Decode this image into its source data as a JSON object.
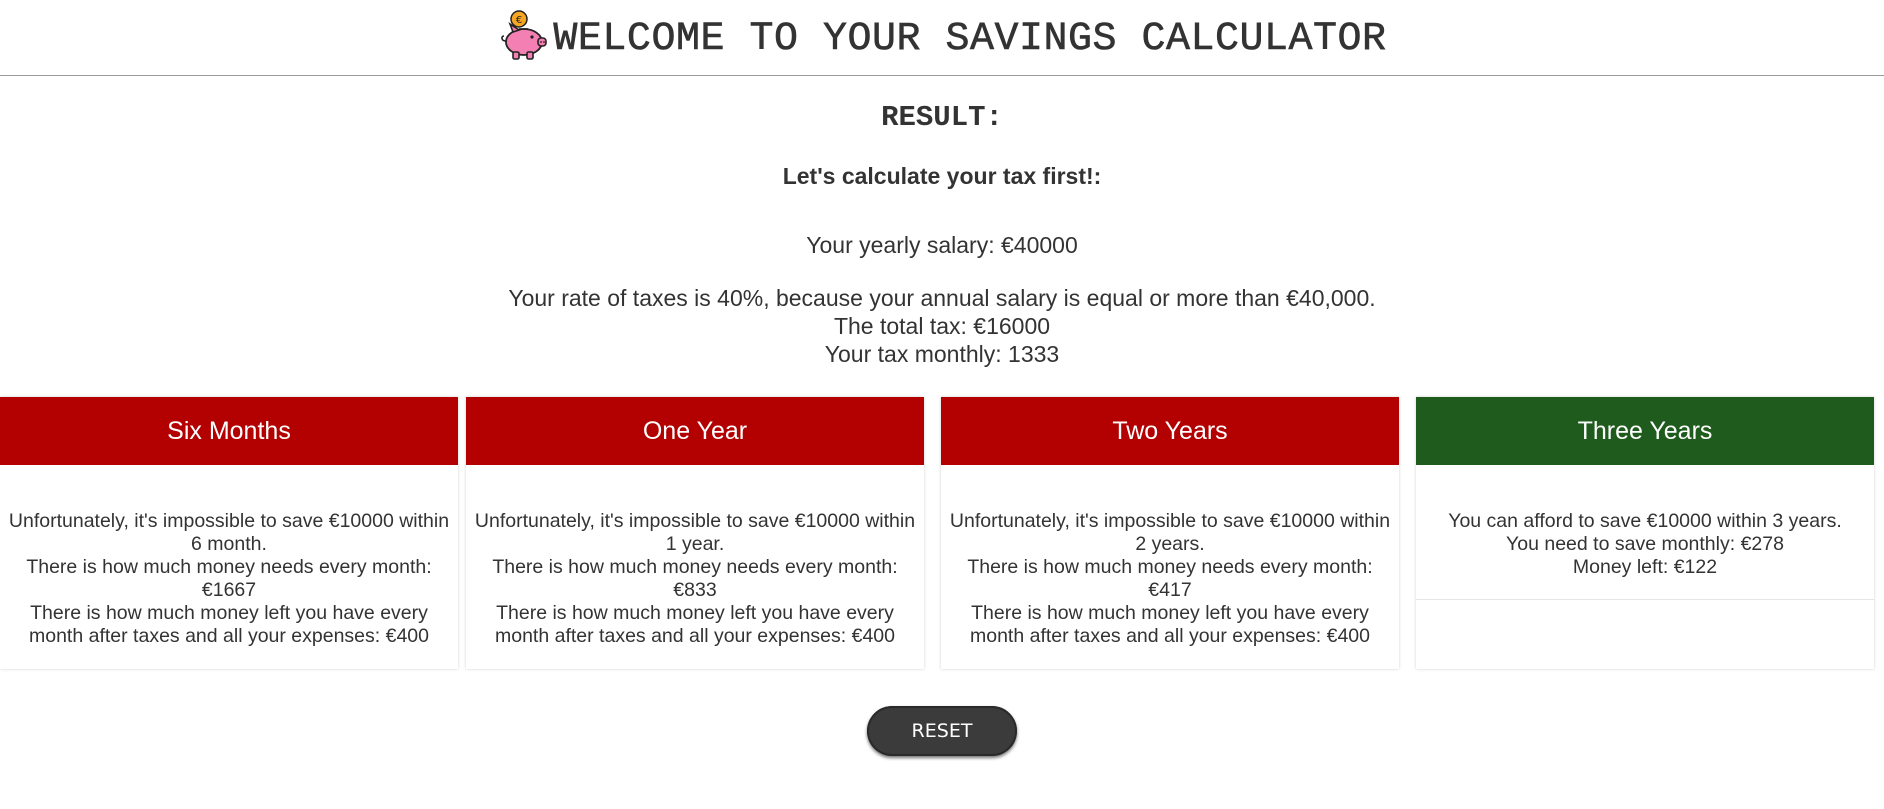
{
  "header": {
    "title": "WELCOME TO YOUR SAVINGS CALCULATOR",
    "logo_icon": "piggy-bank-coin-icon"
  },
  "result": {
    "heading": "RESULT:",
    "tax_heading": "Let's calculate your tax first!:",
    "salary_line": "Your yearly salary: €40000",
    "rate_line": "Your rate of taxes is 40%, because your annual salary is equal or more than €40,000.",
    "total_tax_line": "The total tax: €16000",
    "monthly_tax_line": "Your tax monthly: 1333"
  },
  "cards": [
    {
      "title": "Six Months",
      "color": "#b30000",
      "lines": [
        "Unfortunately, it's impossible to save €10000 within 6 month.",
        "There is how much money needs every month: €1667",
        "There is how much money left you have every month after taxes and all your expenses: €400"
      ]
    },
    {
      "title": "One Year",
      "color": "#b30000",
      "lines": [
        "Unfortunately, it's impossible to save €10000 within 1 year.",
        "There is how much money needs every month: €833",
        "There is how much money left you have every month after taxes and all your expenses: €400"
      ]
    },
    {
      "title": "Two Years",
      "color": "#b30000",
      "lines": [
        "Unfortunately, it's impossible to save €10000 within 2 years.",
        "There is how much money needs every month: €417",
        "There is how much money left you have every month after taxes and all your expenses: €400"
      ]
    },
    {
      "title": "Three Years",
      "color": "#1e5b1c",
      "lines": [
        "You can afford to save €10000 within 3 years.",
        "You need to save monthly: €278",
        "Money left: €122"
      ]
    }
  ],
  "reset_label": "RESET"
}
